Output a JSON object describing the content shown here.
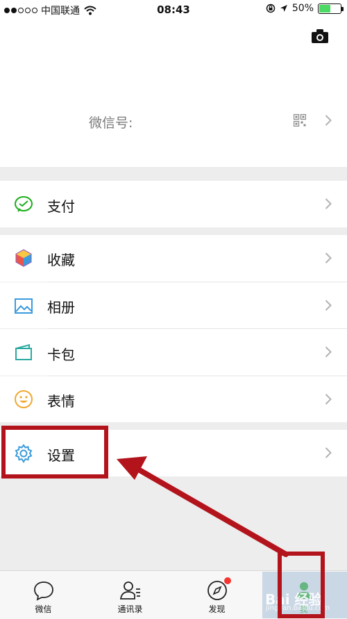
{
  "status_bar": {
    "carrier": "中国联通",
    "time": "08:43",
    "battery": "50%"
  },
  "profile": {
    "wechat_id_label": "微信号:"
  },
  "menu": {
    "pay": "支付",
    "favorites": "收藏",
    "album": "相册",
    "cards": "卡包",
    "stickers": "表情",
    "settings": "设置"
  },
  "tabs": [
    {
      "label": "微信",
      "icon": "chat-bubble-icon"
    },
    {
      "label": "通讯录",
      "icon": "contacts-icon"
    },
    {
      "label": "发现",
      "icon": "compass-icon"
    },
    {
      "label": "我",
      "icon": "me-icon"
    }
  ],
  "watermark": {
    "text": "Bai 经验",
    "sub": "jingyan.baidu.com"
  },
  "colors": {
    "annotation": "#b3141c",
    "wechat_green": "#1aad19",
    "badge": "#f43530"
  }
}
